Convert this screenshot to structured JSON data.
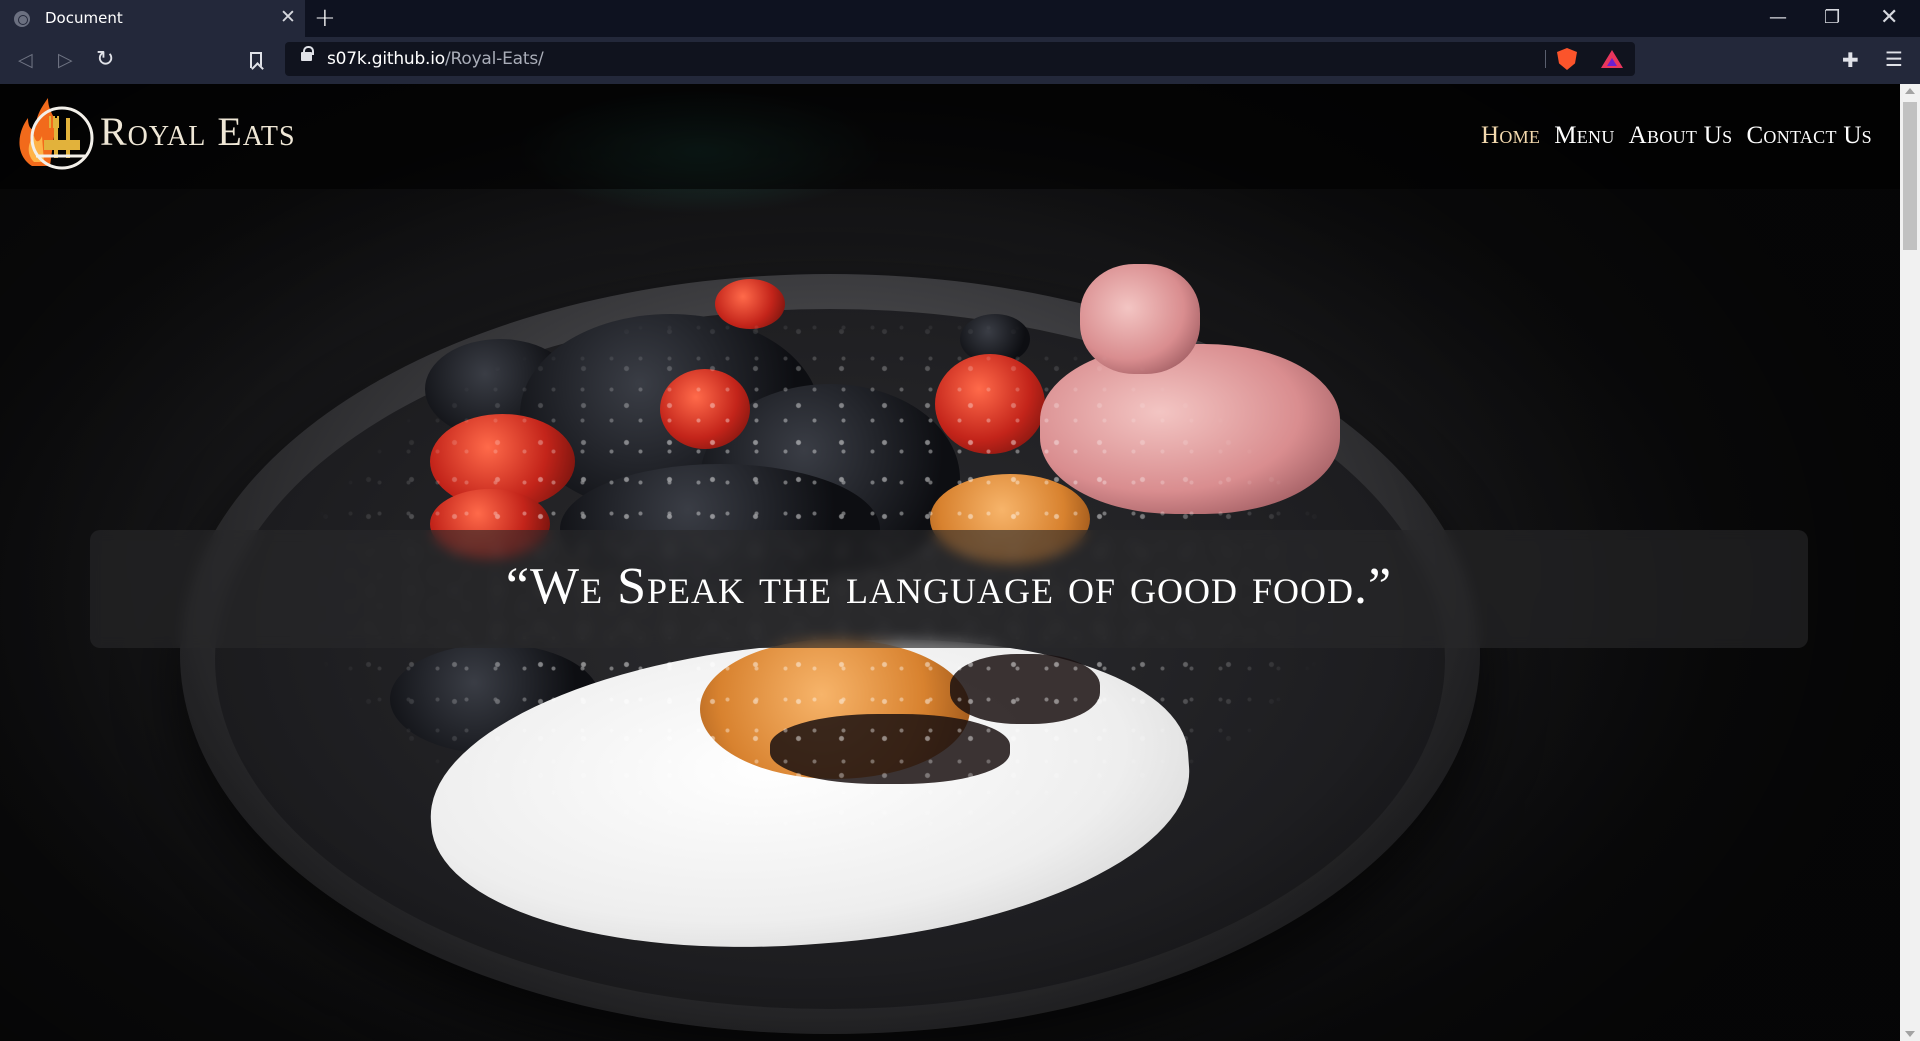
{
  "browser": {
    "tab_title": "Document",
    "tab_close": "✕",
    "new_tab": "+",
    "url_host": "s07k.github.io",
    "url_path": "/Royal-Eats/",
    "icons": [
      "globe-icon",
      "back-icon",
      "forward-icon",
      "reload-icon",
      "bookmark-icon",
      "lock-icon",
      "brave-shield-icon",
      "brave-rewards-icon",
      "extensions-icon",
      "menu-icon"
    ],
    "window_controls": {
      "minimize": "—",
      "maximize": "❐",
      "close": "✕"
    }
  },
  "site": {
    "brand": "Royal Eats",
    "nav": [
      {
        "label": "Home",
        "active": true
      },
      {
        "label": "Menu",
        "active": false
      },
      {
        "label": "About Us",
        "active": false
      },
      {
        "label": "Contact Us",
        "active": false
      }
    ],
    "quote": "“We Speak the language of good food.”",
    "colors": {
      "brand_text": "#efe7d6",
      "nav_active": "#f3d9ae",
      "logo_flame": "#f26a1b",
      "logo_gold": "#e2b23b"
    }
  }
}
